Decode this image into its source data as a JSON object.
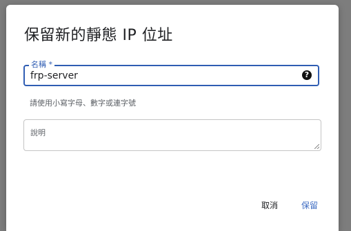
{
  "dialog": {
    "title": "保留新的靜態 IP 位址",
    "name_field": {
      "label": "名稱 *",
      "value": "frp-server",
      "help_icon": "?",
      "hint": "請使用小寫字母、數字或連字號"
    },
    "description_field": {
      "placeholder": "說明"
    },
    "buttons": {
      "cancel_label": "取消",
      "save_label": "保留"
    }
  },
  "colors": {
    "accent": "#2f5db3",
    "primary_button": "#3c6bc2",
    "backdrop": "#7d7d7d"
  }
}
